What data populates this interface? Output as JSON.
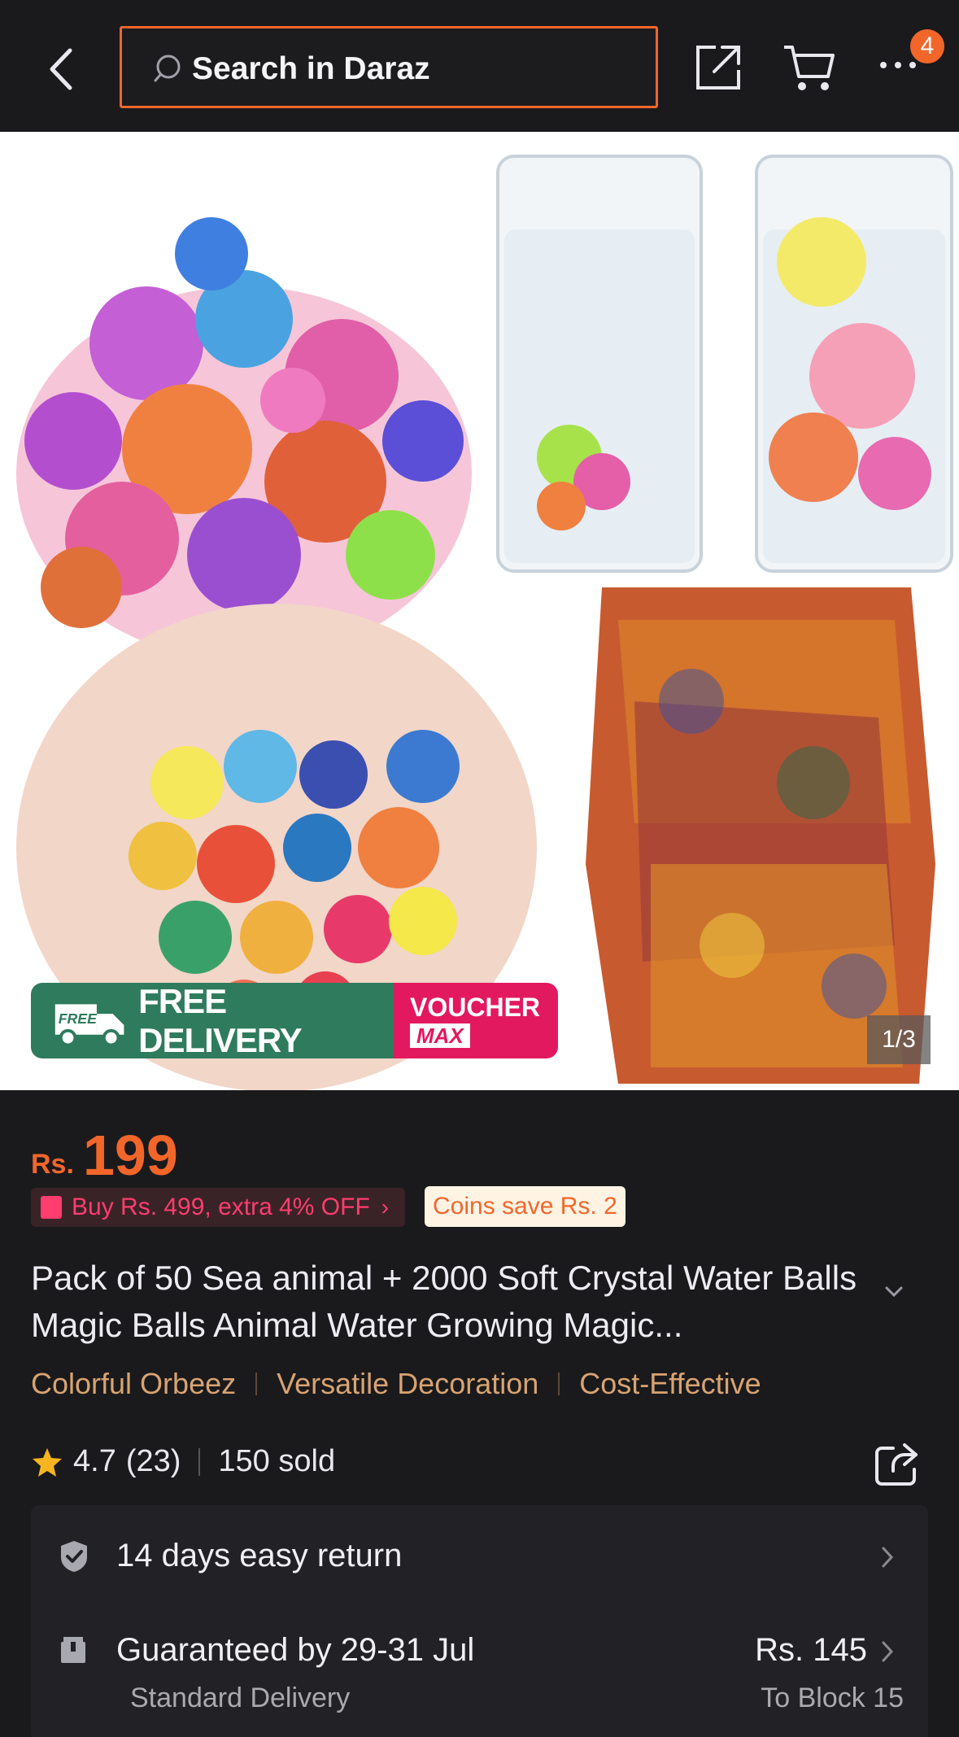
{
  "header": {
    "search_placeholder": "Search in Daraz",
    "cart_badge": "4"
  },
  "gallery": {
    "promo_free_delivery": "FREE DELIVERY",
    "promo_free_tag": "FREE",
    "promo_voucher": "VOUCHER",
    "promo_max": "MAX",
    "counter": "1/3"
  },
  "product": {
    "currency": "Rs.",
    "price": "199",
    "deal_chip": "Buy Rs. 499, extra 4% OFF",
    "coins_chip": "Coins save Rs. 2",
    "title": "Pack of 50 Sea animal + 2000 Soft Crystal Water Balls Magic Balls Animal Water Growing Magic...",
    "tags": [
      "Colorful Orbeez",
      "Versatile Decoration",
      "Cost-Effective"
    ],
    "rating": "4.7",
    "reviews": "(23)",
    "sold": "150 sold"
  },
  "services": {
    "return_text": "14 days easy return",
    "delivery_text": "Guaranteed by 29-31 Jul",
    "delivery_sub": "Standard Delivery",
    "delivery_price": "Rs. 145",
    "delivery_location": "To Block 15"
  },
  "colors": {
    "accent": "#f2662a",
    "background": "#1a1a1c",
    "voucher_pink": "#e3195f",
    "delivery_green": "#2f7b5e",
    "tag_text": "#d9a371"
  }
}
